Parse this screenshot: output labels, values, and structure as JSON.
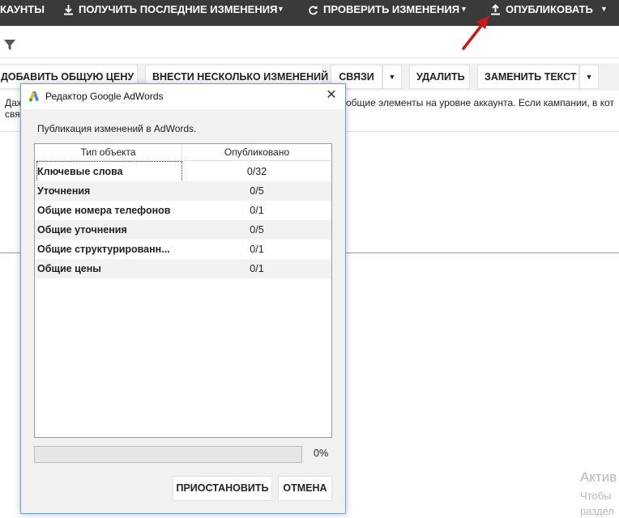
{
  "toolbar": {
    "accounts_label": "КАУНТЫ",
    "get_changes_label": "ПОЛУЧИТЬ ПОСЛЕДНИЕ ИЗМЕНЕНИЯ",
    "check_changes_label": "ПРОВЕРИТЬ ИЗМЕНЕНИЯ",
    "publish_label": "ОПУБЛИКОВАТЬ"
  },
  "actions": {
    "add_shared_price": "ДОБАВИТЬ ОБЩУЮ ЦЕНУ",
    "multiple_changes": "ВНЕСТИ НЕСКОЛЬКО ИЗМЕНЕНИЙ",
    "links": "СВЯЗИ",
    "delete": "УДАЛИТЬ",
    "replace_text": "ЗАМЕНИТЬ ТЕКСТ"
  },
  "background": {
    "text_line1_left": "Даж",
    "text_line1_right": "общие элементы на уровне аккаунта. Если кампании, в кот",
    "text_line2_left": "свя"
  },
  "watermark": {
    "title": "Актив",
    "line1": "Чтобы",
    "line2": "раздел"
  },
  "dialog": {
    "title": "Редактор Google AdWords",
    "message": "Публикация изменений в AdWords.",
    "columns": {
      "type": "Тип объекта",
      "published": "Опубликовано"
    },
    "rows": [
      {
        "type": "Ключевые слова",
        "published": "0/32"
      },
      {
        "type": "Уточнения",
        "published": "0/5"
      },
      {
        "type": "Общие номера телефонов",
        "published": "0/1"
      },
      {
        "type": "Общие уточнения",
        "published": "0/5"
      },
      {
        "type": "Общие структурированн...",
        "published": "0/1"
      },
      {
        "type": "Общие цены",
        "published": "0/1"
      }
    ],
    "progress_percent": "0%",
    "progress_value": 0,
    "pause_label": "ПРИОСТАНОВИТЬ",
    "cancel_label": "ОТМЕНА"
  },
  "colors": {
    "toolbar_bg": "#3a3a3a",
    "dialog_border": "#6a9fd6",
    "annotation_arrow": "#c8191b",
    "adwords_blue": "#4285f4",
    "adwords_green": "#34a853"
  },
  "icons": {
    "get_changes": "download-icon",
    "check_changes": "refresh-icon",
    "publish": "upload-icon",
    "filter": "filter-icon",
    "dialog_logo": "adwords-logo-icon",
    "dialog_close": "close-icon"
  }
}
